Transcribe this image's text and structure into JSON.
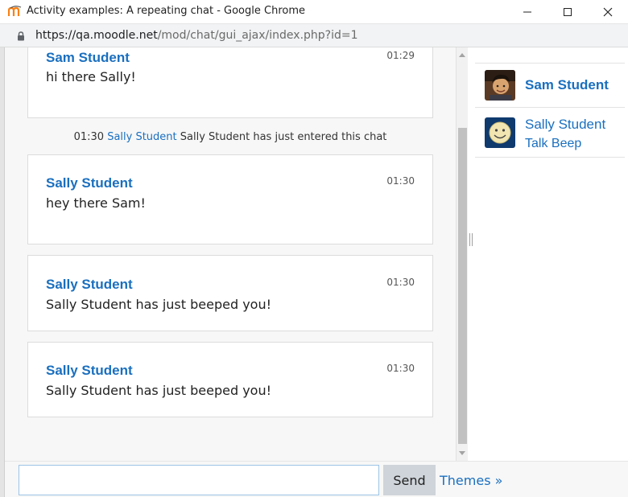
{
  "window": {
    "title": "Activity examples: A repeating chat - Google Chrome",
    "url_host": "https://qa.moodle.net",
    "url_path": "/mod/chat/gui_ajax/index.php?id=1"
  },
  "messages": [
    {
      "author": "Sam Student",
      "time": "01:29",
      "text": "hi there Sally!"
    },
    {
      "author": "Sally Student",
      "time": "01:30",
      "text": "hey there Sam!"
    },
    {
      "author": "Sally Student",
      "time": "01:30",
      "text": "Sally Student has just beeped you!"
    },
    {
      "author": "Sally Student",
      "time": "01:30",
      "text": "Sally Student has just beeped you!"
    }
  ],
  "system_message": {
    "time": "01:30",
    "user": "Sally Student",
    "text": "Sally Student has just entered this chat"
  },
  "users": [
    {
      "name": "Sam Student"
    },
    {
      "name": "Sally Student",
      "action": "Talk Beep"
    }
  ],
  "input": {
    "value": "",
    "placeholder": "",
    "send_label": "Send",
    "themes_label": "Themes »"
  },
  "colors": {
    "link": "#1a6fbf",
    "card_border": "#dcdcdc",
    "input_border": "#9cc4e6",
    "send_button": "#ced4da"
  },
  "icons": {
    "app": "moodle-logo-icon",
    "lock": "lock-icon",
    "minimize": "minimize-icon",
    "maximize": "maximize-icon",
    "close": "close-icon"
  }
}
